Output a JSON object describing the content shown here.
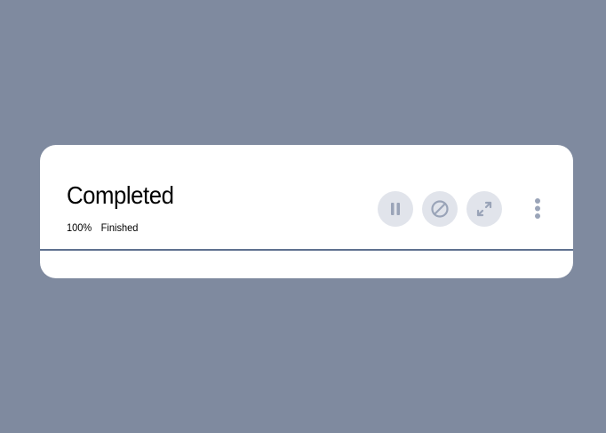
{
  "download": {
    "status_title": "Completed",
    "percent_text": "100%",
    "state_text": "Finished",
    "progress": 1.0
  },
  "actions": {
    "pause_icon": "pause-icon",
    "cancel_icon": "cancel-icon",
    "expand_icon": "expand-icon",
    "more_icon": "more-vertical-icon"
  },
  "colors": {
    "background": "#7f8a9f",
    "card": "#ffffff",
    "button_bg": "#e1e4eb",
    "icon": "#9aa4b8",
    "progress": "#5f7190"
  }
}
